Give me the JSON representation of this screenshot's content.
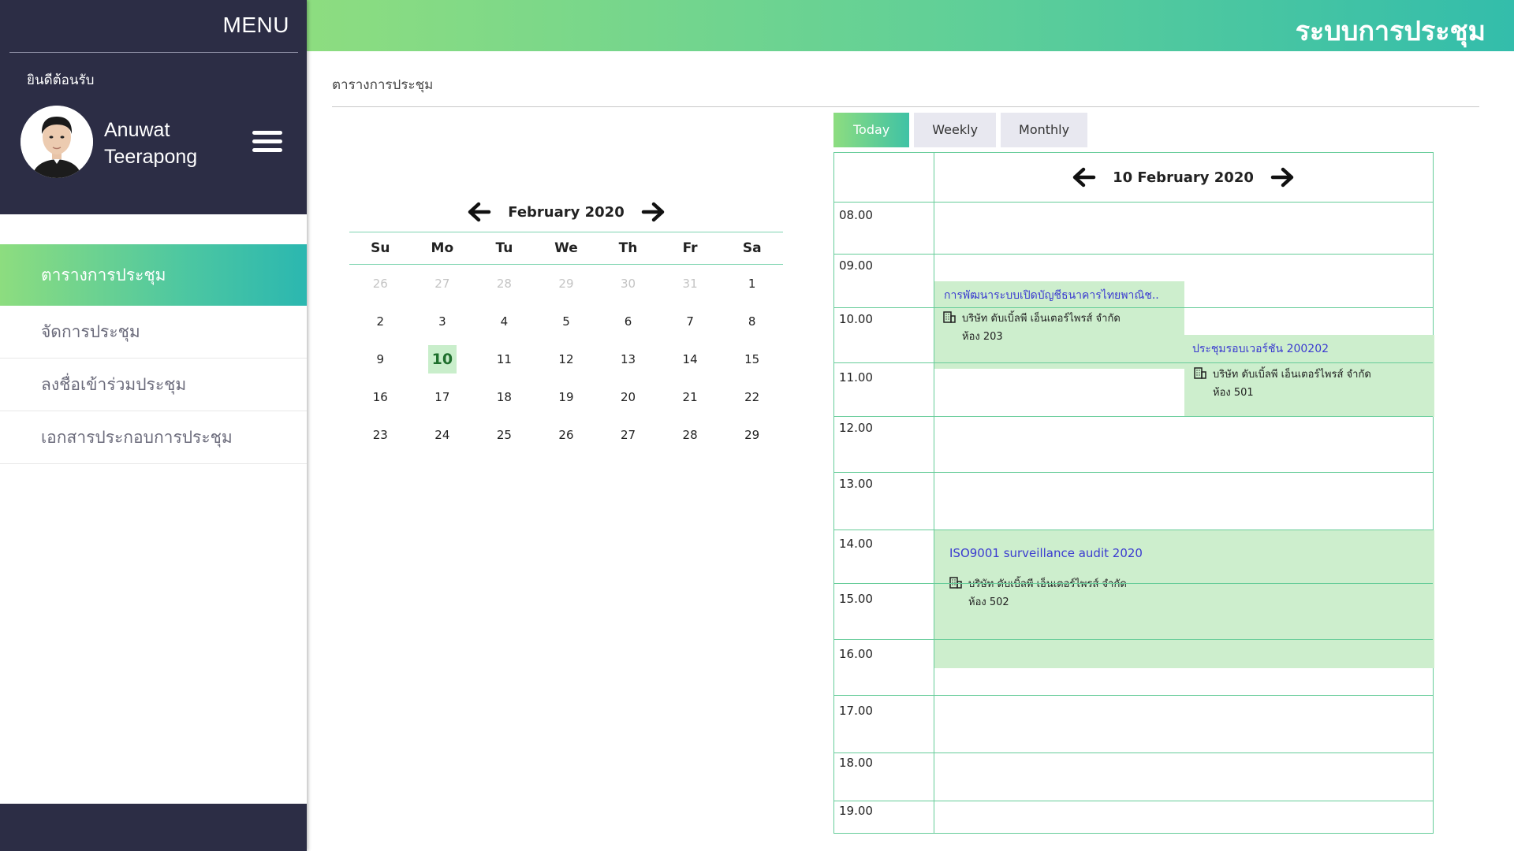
{
  "app": {
    "title": "ระบบการประชุม"
  },
  "sidebar": {
    "menu_label": "MENU",
    "welcome": "ยินดีต้อนรับ",
    "user": {
      "first_name": "Anuwat",
      "last_name": "Teerapong"
    },
    "items": [
      {
        "label": "ตารางการประชุม",
        "active": true
      },
      {
        "label": "จัดการประชุม",
        "active": false
      },
      {
        "label": "ลงชื่อเข้าร่วมประชุม",
        "active": false
      },
      {
        "label": "เอกสารประกอบการประชุม",
        "active": false
      }
    ]
  },
  "page": {
    "title": "ตารางการประชุม"
  },
  "mini_calendar": {
    "month_label": "February 2020",
    "weekdays": [
      "Su",
      "Mo",
      "Tu",
      "We",
      "Th",
      "Fr",
      "Sa"
    ],
    "weeks": [
      [
        "26",
        "27",
        "28",
        "29",
        "30",
        "31",
        "1"
      ],
      [
        "2",
        "3",
        "4",
        "5",
        "6",
        "7",
        "8"
      ],
      [
        "9",
        "10",
        "11",
        "12",
        "13",
        "14",
        "15"
      ],
      [
        "16",
        "17",
        "18",
        "19",
        "20",
        "21",
        "22"
      ],
      [
        "23",
        "24",
        "25",
        "26",
        "27",
        "28",
        "29"
      ]
    ],
    "selected_day": "10"
  },
  "view_tabs": [
    {
      "label": "Today",
      "active": true
    },
    {
      "label": "Weekly",
      "active": false
    },
    {
      "label": "Monthly",
      "active": false
    }
  ],
  "day_view": {
    "date_label": "10 February 2020",
    "hours": [
      "08.00",
      "09.00",
      "10.00",
      "11.00",
      "12.00",
      "13.00",
      "14.00",
      "15.00",
      "16.00",
      "17.00",
      "18.00",
      "19.00"
    ],
    "events": [
      {
        "title": "การพัฒนาระบบเปิดบัญชีธนาคารไทยพาณิช..",
        "org": "บริษัท ดับเบิ้ลพี เอ็นเตอร์ไพรส์ จำกัด",
        "room": "ห้อง 203"
      },
      {
        "title": "ประชุมรอบเวอร์ชัน 200202",
        "org": "บริษัท ดับเบิ้ลพี เอ็นเตอร์ไพรส์ จำกัด",
        "room": "ห้อง 501"
      },
      {
        "title": "ISO9001 surveillance audit 2020",
        "org": "บริษัท ดับเบิ้ลพี เอ็นเตอร์ไพรส์ จำกัด",
        "room": "ห้อง 502"
      }
    ]
  },
  "colors": {
    "sidebar_bg": "#2c2d45",
    "accent_gradient_start": "#8ddd80",
    "accent_gradient_end": "#33bdab",
    "event_bg": "#cdeecd",
    "event_title": "#3a3ad0"
  }
}
